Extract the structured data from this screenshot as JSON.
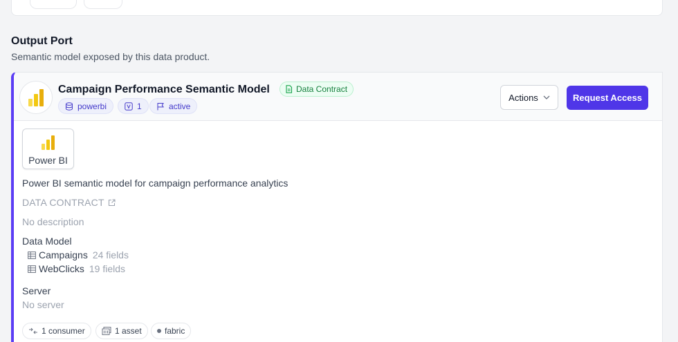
{
  "section": {
    "title": "Output Port",
    "subtitle": "Semantic model exposed by this data product."
  },
  "port": {
    "name": "Campaign Performance Semantic Model",
    "contract_badge": "Data Contract",
    "tags": [
      {
        "icon": "database-icon",
        "label": "powerbi"
      },
      {
        "icon": "version-icon",
        "label": "1"
      },
      {
        "icon": "flag-icon",
        "label": "active"
      }
    ],
    "actions_label": "Actions",
    "request_label": "Request Access"
  },
  "platform": {
    "icon": "powerbi-icon",
    "label": "Power BI"
  },
  "description": "Power BI semantic model for campaign performance analytics",
  "data_contract": {
    "label": "DATA CONTRACT",
    "description": "No description"
  },
  "data_model": {
    "label": "Data Model",
    "tables": [
      {
        "name": "Campaigns",
        "fields": "24 fields"
      },
      {
        "name": "WebClicks",
        "fields": "19 fields"
      }
    ]
  },
  "server": {
    "label": "Server",
    "value": "No server"
  },
  "chips": [
    {
      "icon": "consumer-icon",
      "label": "1 consumer"
    },
    {
      "icon": "asset-icon",
      "label": "1 asset"
    },
    {
      "icon": "dot-icon",
      "label": "fabric"
    }
  ],
  "colors": {
    "accent": "#5b3df5",
    "request_button": "#4f36e8",
    "contract_green": "#15803d",
    "tag_text": "#4338ca",
    "powerbi_yellow": "#f2c811"
  }
}
